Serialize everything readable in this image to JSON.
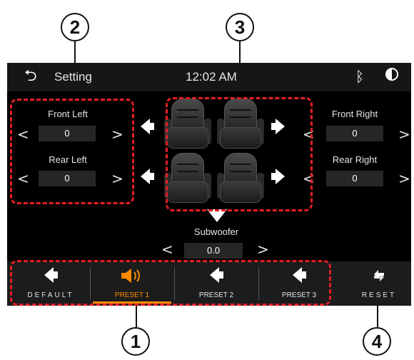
{
  "callouts": [
    "2",
    "3",
    "1",
    "4"
  ],
  "status": {
    "title": "Setting",
    "time": "12:02 AM",
    "back_icon": "back-arrow-icon",
    "bt_icon": "bluetooth-icon",
    "brightness_icon": "brightness-icon"
  },
  "channels": {
    "front_left": {
      "label": "Front Left",
      "value": "0"
    },
    "rear_left": {
      "label": "Rear Left",
      "value": "0"
    },
    "front_right": {
      "label": "Front Right",
      "value": "0"
    },
    "rear_right": {
      "label": "Rear Right",
      "value": "0"
    },
    "subwoofer": {
      "label": "Subwoofer",
      "value": "0.0"
    }
  },
  "presets": [
    {
      "label": "DEFAULT"
    },
    {
      "label": "PRESET 1",
      "active": true
    },
    {
      "label": "PRESET 2"
    },
    {
      "label": "PRESET 3"
    }
  ],
  "reset": {
    "label": "RESET"
  },
  "colors": {
    "accent": "#ff8a00",
    "highlight_outline": "#e31e24",
    "background": "#000000"
  }
}
